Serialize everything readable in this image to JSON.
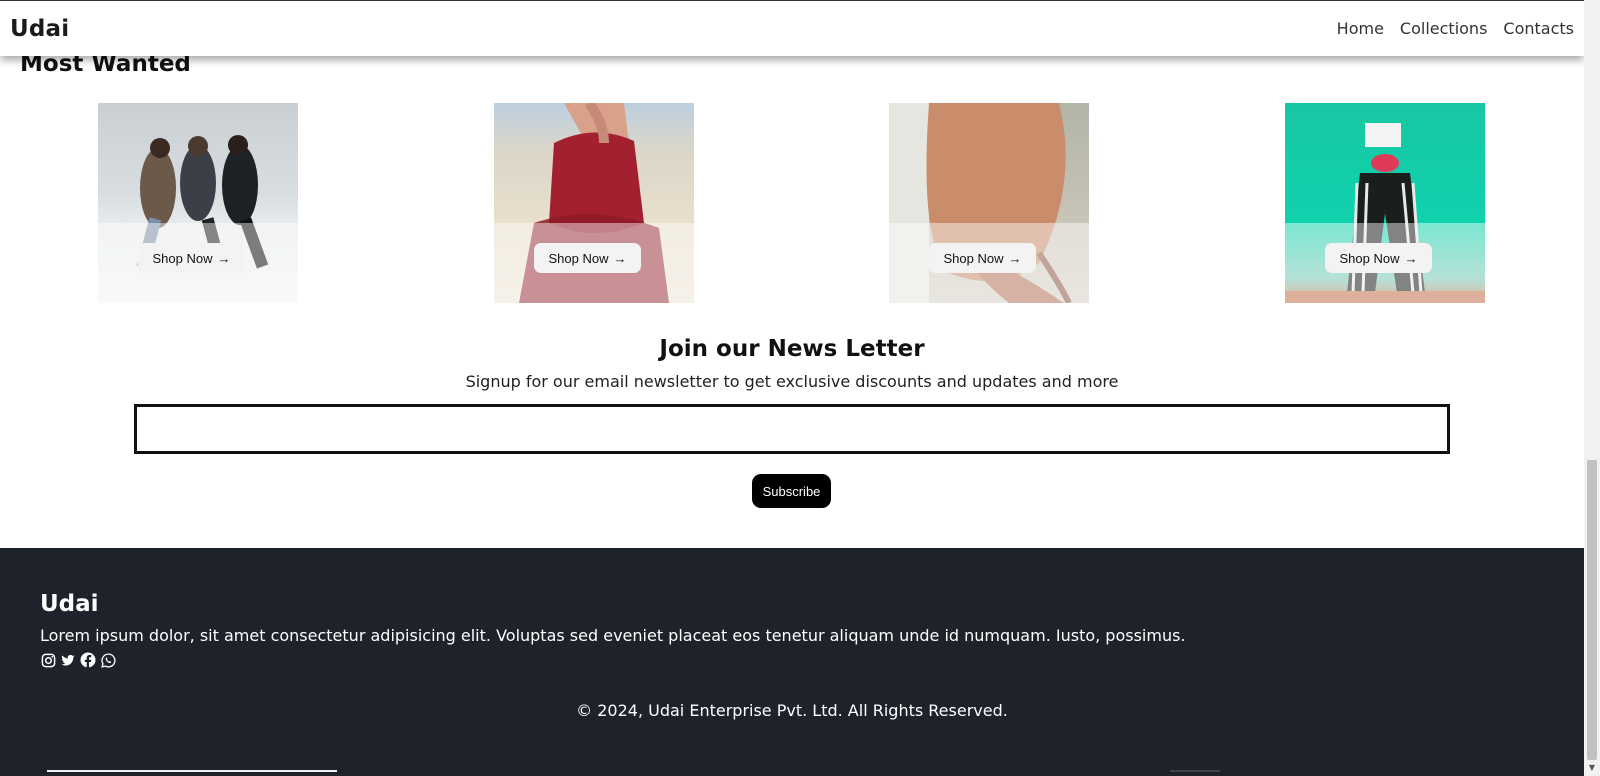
{
  "header": {
    "brand": "Udai",
    "nav": [
      "Home",
      "Collections",
      "Contacts"
    ]
  },
  "most_wanted": {
    "title": "Most Wanted",
    "cards": [
      {
        "image": "group-jumping-photo",
        "button_label": "Shop Now"
      },
      {
        "image": "red-dress-photo",
        "button_label": "Shop Now"
      },
      {
        "image": "peach-blouse-photo",
        "button_label": "Shop Now"
      },
      {
        "image": "striped-pants-photo",
        "button_label": "Shop Now"
      }
    ]
  },
  "newsletter": {
    "title": "Join our News Letter",
    "subtitle": "Signup for our email newsletter to get exclusive discounts and updates and more",
    "input_placeholder": "",
    "subscribe_label": "Subscribe"
  },
  "footer": {
    "brand": "Udai",
    "description": "Lorem ipsum dolor, sit amet consectetur adipisicing elit. Voluptas sed eveniet placeat eos tenetur aliquam unde id numquam. Iusto, possimus.",
    "social_icons": [
      "instagram-icon",
      "twitter-icon",
      "facebook-icon",
      "whatsapp-icon"
    ],
    "copyright": "© 2024, Udai Enterprise Pvt. Ltd. All Rights Reserved."
  },
  "colors": {
    "footer_bg": "#1d222b",
    "button_black": "#000000",
    "accent_white": "#ffffff"
  }
}
